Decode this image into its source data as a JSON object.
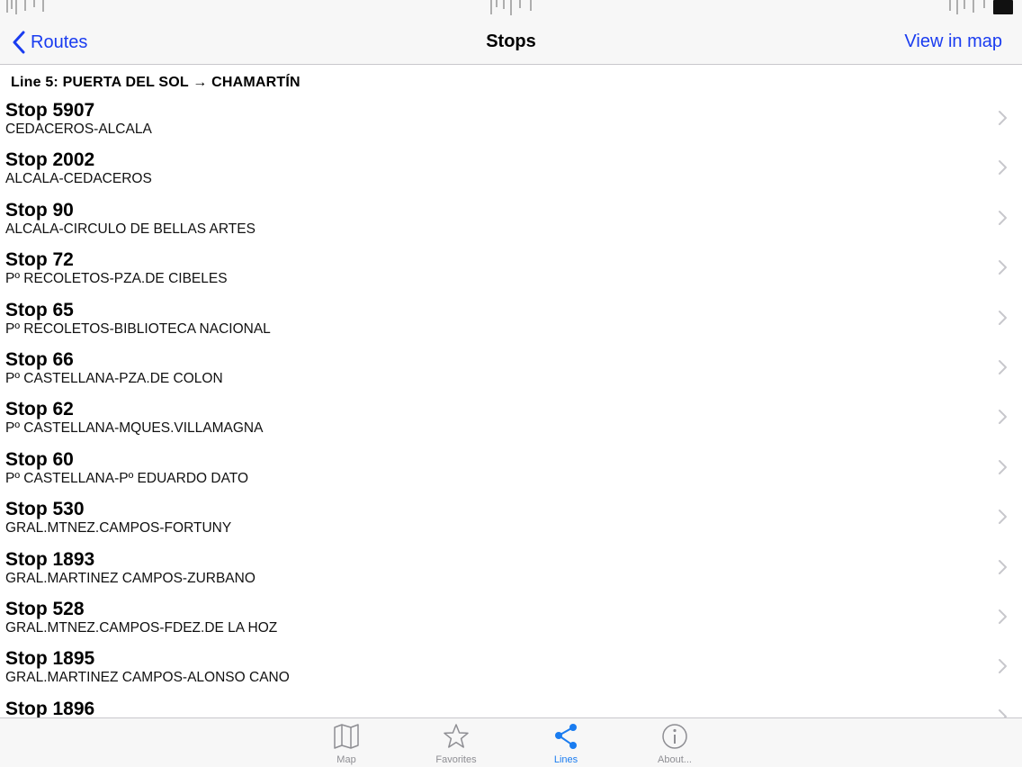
{
  "nav": {
    "back_label": "Routes",
    "title": "Stops",
    "right_label": "View in map"
  },
  "section": {
    "header": "Line 5: PUERTA DEL SOL → CHAMARTÍN"
  },
  "stops": [
    {
      "title": "Stop 5907",
      "subtitle": "CEDACEROS-ALCALA"
    },
    {
      "title": "Stop 2002",
      "subtitle": "ALCALA-CEDACEROS"
    },
    {
      "title": "Stop 90",
      "subtitle": "ALCALA-CIRCULO DE BELLAS ARTES"
    },
    {
      "title": "Stop 72",
      "subtitle": "Pº RECOLETOS-PZA.DE CIBELES"
    },
    {
      "title": "Stop 65",
      "subtitle": "Pº RECOLETOS-BIBLIOTECA NACIONAL"
    },
    {
      "title": "Stop 66",
      "subtitle": "Pº CASTELLANA-PZA.DE COLON"
    },
    {
      "title": "Stop 62",
      "subtitle": "Pº CASTELLANA-MQUES.VILLAMAGNA"
    },
    {
      "title": "Stop 60",
      "subtitle": "Pº CASTELLANA-Pº EDUARDO DATO"
    },
    {
      "title": "Stop 530",
      "subtitle": "GRAL.MTNEZ.CAMPOS-FORTUNY"
    },
    {
      "title": "Stop 1893",
      "subtitle": "GRAL.MARTINEZ CAMPOS-ZURBANO"
    },
    {
      "title": "Stop 528",
      "subtitle": "GRAL.MTNEZ.CAMPOS-FDEZ.DE LA HOZ"
    },
    {
      "title": "Stop 1895",
      "subtitle": "GRAL.MARTINEZ CAMPOS-ALONSO CANO"
    },
    {
      "title": "Stop 1896",
      "subtitle": ""
    }
  ],
  "tabs": [
    {
      "label": "Map",
      "icon": "map-icon",
      "active": false
    },
    {
      "label": "Favorites",
      "icon": "star-icon",
      "active": false
    },
    {
      "label": "Lines",
      "icon": "share-icon",
      "active": true
    },
    {
      "label": "About...",
      "icon": "info-icon",
      "active": false
    }
  ],
  "colors": {
    "accent": "#1a3cf0",
    "tab_active": "#1a7cf0",
    "tab_inactive": "#8e8e93",
    "chevron": "#c7c7cc",
    "bar_background": "#f7f7f7"
  }
}
